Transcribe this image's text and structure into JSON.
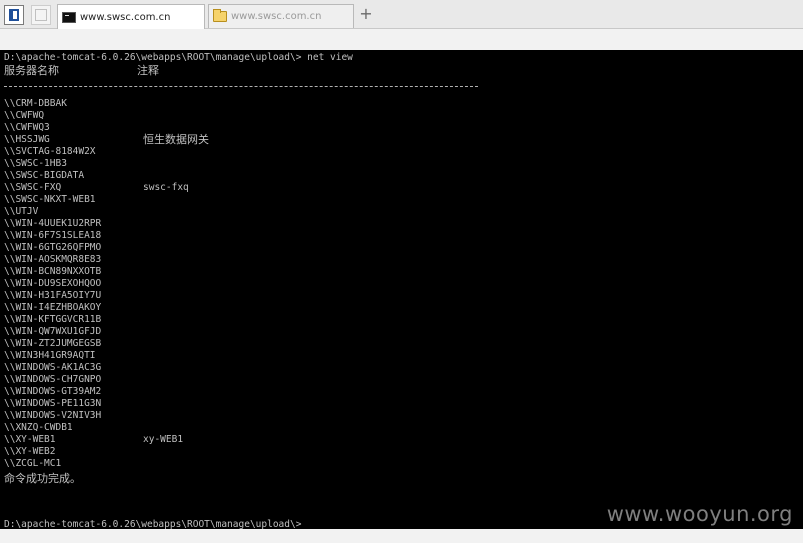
{
  "tabs": [
    {
      "label": "www.swsc.com.cn",
      "icon": "console-icon",
      "active": true
    },
    {
      "label": "www.swsc.com.cn",
      "icon": "folder-icon",
      "active": false
    }
  ],
  "new_tab_symbol": "+",
  "console": {
    "prompt_command": "D:\\apache-tomcat-6.0.26\\webapps\\ROOT\\manage\\upload\\> net view",
    "header_name": "服务器名称",
    "header_note": "注释",
    "rows": [
      {
        "name": "\\\\CRM-DBBAK",
        "note": ""
      },
      {
        "name": "\\\\CWFWQ",
        "note": ""
      },
      {
        "name": "\\\\CWFWQ3",
        "note": ""
      },
      {
        "name": "\\\\HSSJWG",
        "note": "恒生数据网关"
      },
      {
        "name": "\\\\SVCTAG-8184W2X",
        "note": ""
      },
      {
        "name": "\\\\SWSC-1HB3",
        "note": ""
      },
      {
        "name": "\\\\SWSC-BIGDATA",
        "note": ""
      },
      {
        "name": "\\\\SWSC-FXQ",
        "note": "swsc-fxq"
      },
      {
        "name": "\\\\SWSC-NKXT-WEB1",
        "note": ""
      },
      {
        "name": "\\\\UTJV",
        "note": ""
      },
      {
        "name": "\\\\WIN-4UUEK1U2RPR",
        "note": ""
      },
      {
        "name": "\\\\WIN-6F7S1SLEA18",
        "note": ""
      },
      {
        "name": "\\\\WIN-6GTG26QFPMO",
        "note": ""
      },
      {
        "name": "\\\\WIN-AOSKMQR8E83",
        "note": ""
      },
      {
        "name": "\\\\WIN-BCN89NXXOTB",
        "note": ""
      },
      {
        "name": "\\\\WIN-DU9SEXOHQOO",
        "note": ""
      },
      {
        "name": "\\\\WIN-H31FA5OIY7U",
        "note": ""
      },
      {
        "name": "\\\\WIN-I4EZHBOAKOY",
        "note": ""
      },
      {
        "name": "\\\\WIN-KFTGGVCR11B",
        "note": ""
      },
      {
        "name": "\\\\WIN-QW7WXU1GFJD",
        "note": ""
      },
      {
        "name": "\\\\WIN-ZT2JUMGEGSB",
        "note": ""
      },
      {
        "name": "\\\\WIN3H41GR9AQTI",
        "note": ""
      },
      {
        "name": "\\\\WINDOWS-AK1AC3G",
        "note": ""
      },
      {
        "name": "\\\\WINDOWS-CH7GNPO",
        "note": ""
      },
      {
        "name": "\\\\WINDOWS-GT39AM2",
        "note": ""
      },
      {
        "name": "\\\\WINDOWS-PE11G3N",
        "note": ""
      },
      {
        "name": "\\\\WINDOWS-V2NIV3H",
        "note": ""
      },
      {
        "name": "\\\\XNZQ-CWDB1",
        "note": ""
      },
      {
        "name": "\\\\XY-WEB1",
        "note": "xy-WEB1"
      },
      {
        "name": "\\\\XY-WEB2",
        "note": ""
      },
      {
        "name": "\\\\ZCGL-MC1",
        "note": ""
      }
    ],
    "completion_message": "命令成功完成。",
    "prompt_idle": "D:\\apache-tomcat-6.0.26\\webapps\\ROOT\\manage\\upload\\>"
  },
  "watermark": "www.wooyun.org"
}
